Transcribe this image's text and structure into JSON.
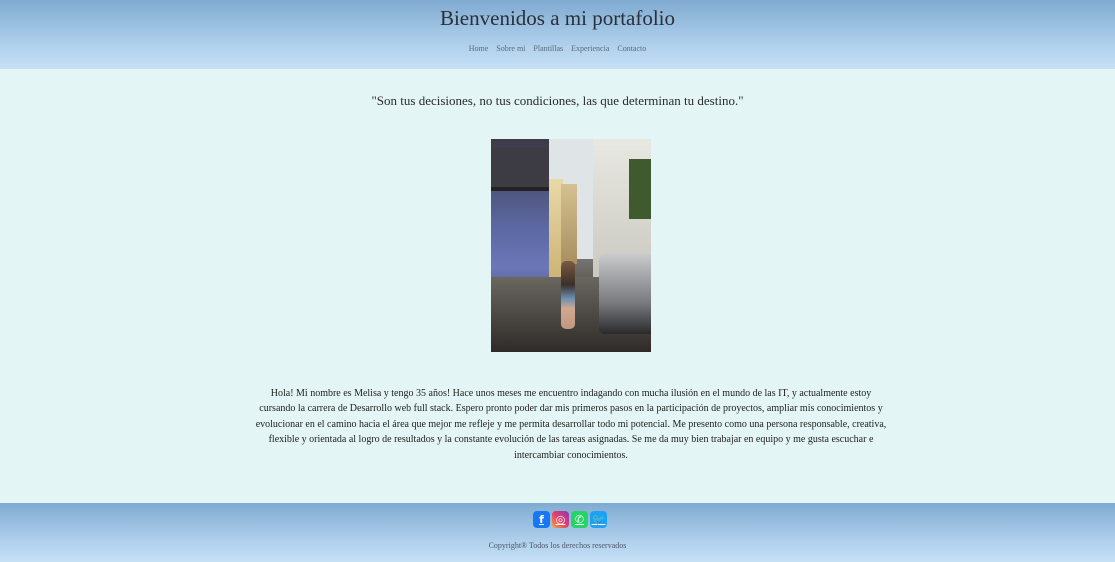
{
  "header": {
    "title": "Bienvenidos a mi portafolio",
    "nav": [
      "Home",
      "Sobre mi",
      "Plantillas",
      "Experiencia",
      "Contacto"
    ]
  },
  "main": {
    "quote": "\"Son tus decisiones, no tus condiciones, las que determinan tu destino.\"",
    "bio": "Hola! Mi nombre es Melisa y tengo 35 años! Hace unos meses me encuentro indagando con mucha ilusión en el mundo de las IT, y actualmente estoy cursando la carrera de Desarrollo web full stack. Espero pronto poder dar mis primeros pasos en la participación de proyectos, ampliar mis conocimientos y evolucionar en el camino hacia el área que mejor me refleje y me permita desarrollar todo mi potencial. Me presento como una persona responsable, creativa, flexible y orientada al logro de resultados y la constante evolución de las tareas asignadas. Se me da muy bien trabajar en equipo y me gusta escuchar e intercambiar conocimientos."
  },
  "footer": {
    "social": [
      {
        "icon": "facebook-icon",
        "glyph": "f",
        "color": "#1877f2"
      },
      {
        "icon": "instagram-icon",
        "glyph": "◎",
        "color": "#e33c6e"
      },
      {
        "icon": "whatsapp-icon",
        "glyph": "✆",
        "color": "#25d366"
      },
      {
        "icon": "twitter-icon",
        "glyph": "🐦",
        "color": "#1da1f2"
      }
    ],
    "copyright": "Copyright® Todos los derechos reservados"
  }
}
